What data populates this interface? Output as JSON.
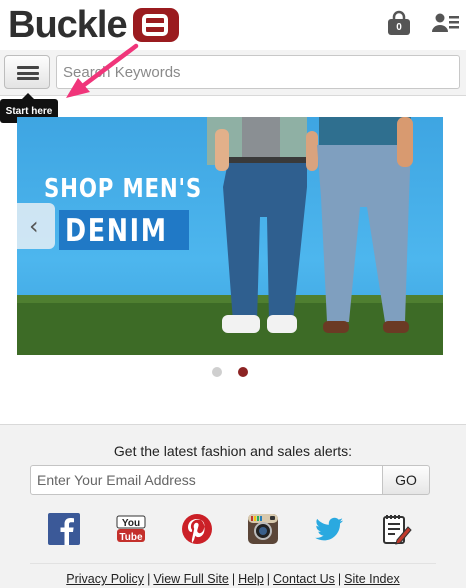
{
  "header": {
    "brand": "Buckle",
    "cart_count": "0"
  },
  "search": {
    "placeholder": "Search Keywords"
  },
  "annotation": {
    "tooltip": "Start here",
    "arrow_color": "#f0357a"
  },
  "banner": {
    "line1": "SHOP MEN'S",
    "line2": "DENIM",
    "slides": 2,
    "active_slide": 2
  },
  "footer": {
    "alerts_text": "Get the latest fashion and sales alerts:",
    "email_placeholder": "Enter Your Email Address",
    "go_label": "GO",
    "social": [
      "facebook-icon",
      "youtube-icon",
      "pinterest-icon",
      "instagram-icon",
      "twitter-icon",
      "blog-icon"
    ],
    "links": [
      "Privacy Policy",
      "View Full Site",
      "Help",
      "Contact Us",
      "Site Index"
    ]
  },
  "colors": {
    "brand_red": "#9a1b1f",
    "banner_blue": "#4db6ee",
    "dot_active": "#8c2323"
  }
}
